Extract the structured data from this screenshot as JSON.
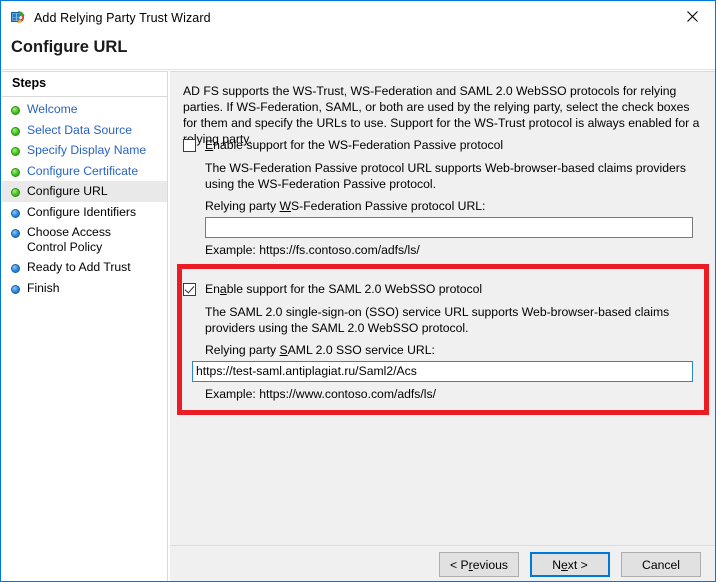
{
  "window": {
    "title": "Add Relying Party Trust Wizard",
    "app_icon": "wizard-app-icon",
    "close_icon": "close-icon",
    "border_color": "#0078d7"
  },
  "header": {
    "page_title": "Configure URL"
  },
  "sidebar": {
    "heading": "Steps",
    "items": [
      {
        "label": "Welcome",
        "state": "done"
      },
      {
        "label": "Select Data Source",
        "state": "done"
      },
      {
        "label": "Specify Display Name",
        "state": "done"
      },
      {
        "label": "Configure Certificate",
        "state": "done"
      },
      {
        "label": "Configure URL",
        "state": "current"
      },
      {
        "label": "Configure Identifiers",
        "state": "todo"
      },
      {
        "label": "Choose Access Control Policy",
        "state": "todo"
      },
      {
        "label": "Ready to Add Trust",
        "state": "todo"
      },
      {
        "label": "Finish",
        "state": "todo"
      }
    ]
  },
  "main": {
    "intro": "AD FS supports the WS-Trust, WS-Federation and SAML 2.0 WebSSO protocols for relying parties.  If WS-Federation, SAML, or both are used by the relying party, select the check boxes for them and specify the URLs to use.  Support for the WS-Trust protocol is always enabled for a relying party.",
    "wsfed": {
      "checkbox_label_pre": "E",
      "checkbox_label_post": "nable support for the WS-Federation Passive protocol",
      "checked": false,
      "description": "The WS-Federation Passive protocol URL supports Web-browser-based claims providers using the WS-Federation Passive protocol.",
      "field_label_pre": "Relying party ",
      "field_label_acc": "W",
      "field_label_post": "S-Federation Passive protocol URL:",
      "field_value": "",
      "field_placeholder": "",
      "example": "Example: https://fs.contoso.com/adfs/ls/"
    },
    "saml": {
      "checkbox_label_pre": "En",
      "checkbox_label_acc": "a",
      "checkbox_label_post": "ble support for the SAML 2.0 WebSSO protocol",
      "checked": true,
      "description": "The SAML 2.0 single-sign-on (SSO) service URL supports Web-browser-based claims providers using the SAML 2.0 WebSSO protocol.",
      "field_label_pre": "Relying party ",
      "field_label_acc": "S",
      "field_label_post": "AML 2.0 SSO service URL:",
      "field_value": "https://test-saml.antiplagiat.ru/Saml2/Acs",
      "field_placeholder": "",
      "example": "Example: https://www.contoso.com/adfs/ls/",
      "highlight_color": "#ec1c24"
    }
  },
  "footer": {
    "previous_pre": "< P",
    "previous_acc": "r",
    "previous_post": "evious",
    "next_pre": "N",
    "next_acc": "e",
    "next_post": "xt >",
    "cancel_label": "Cancel",
    "default_button": "next-button"
  }
}
